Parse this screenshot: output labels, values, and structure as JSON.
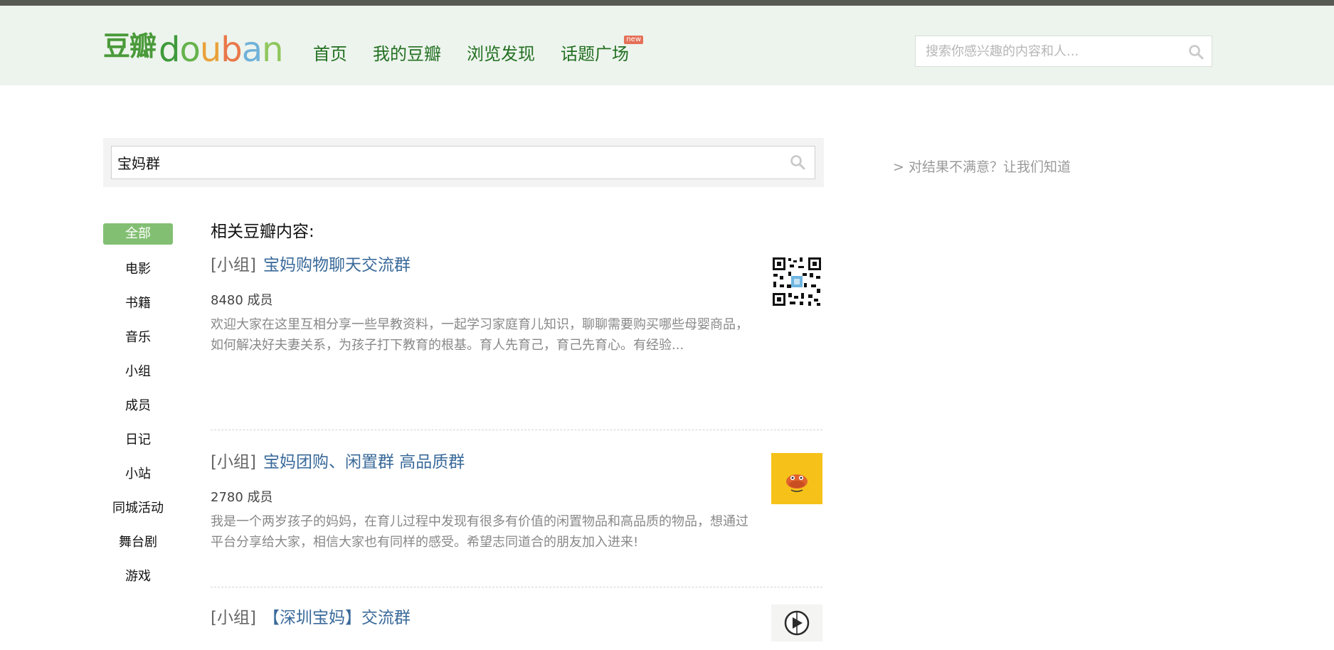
{
  "brand": {
    "logo_cn": "豆瓣",
    "logo_en": "douban",
    "logo_colors": [
      "#3f9a3c",
      "#66b24c",
      "#e9a23a",
      "#e97849",
      "#6fb1d9",
      "#8fc65b"
    ]
  },
  "nav": {
    "items": [
      {
        "label": "首页"
      },
      {
        "label": "我的豆瓣"
      },
      {
        "label": "浏览发现"
      },
      {
        "label": "话题广场",
        "badge": "new"
      }
    ]
  },
  "top_search": {
    "placeholder": "搜索你感兴趣的内容和人...",
    "icon": "search-icon"
  },
  "search": {
    "query": "宝妈群",
    "icon": "search-icon"
  },
  "feedback": "> 对结果不满意？让我们知道",
  "sidebar": {
    "items": [
      {
        "label": "全部",
        "active": true
      },
      {
        "label": "电影"
      },
      {
        "label": "书籍"
      },
      {
        "label": "音乐"
      },
      {
        "label": "小组"
      },
      {
        "label": "成员"
      },
      {
        "label": "日记"
      },
      {
        "label": "小站"
      },
      {
        "label": "同城活动"
      },
      {
        "label": "舞台剧"
      },
      {
        "label": "游戏"
      }
    ]
  },
  "results": {
    "heading": "相关豆瓣内容:",
    "items": [
      {
        "category": "[小组]",
        "title": "宝妈购物聊天交流群",
        "meta": "8480 成员",
        "description": "欢迎大家在这里互相分享一些早教资料，一起学习家庭育儿知识，聊聊需要购买哪些母婴商品，如何解决好夫妻关系，为孩子打下教育的根基。育人先育己，育己先育心。有经验...",
        "thumb": "qr-code-thumbnail"
      },
      {
        "category": "[小组]",
        "title": "宝妈团购、闲置群 高品质群",
        "meta": "2780 成员",
        "description": "我是一个两岁孩子的妈妈，在育儿过程中发现有很多有价值的闲置物品和高品质的物品，想通过平台分享给大家，相信大家也有同样的感受。希望志同道合的朋友加入进来!",
        "thumb": "duck-thumbnail"
      },
      {
        "category": "[小组]",
        "title": "【深圳宝妈】交流群",
        "thumb": "emblem-thumbnail"
      }
    ]
  },
  "colors": {
    "header_bg": "#edf4ed",
    "nav_green": "#237022",
    "link_blue": "#3a6a9a",
    "active_tab": "#83bf73"
  }
}
